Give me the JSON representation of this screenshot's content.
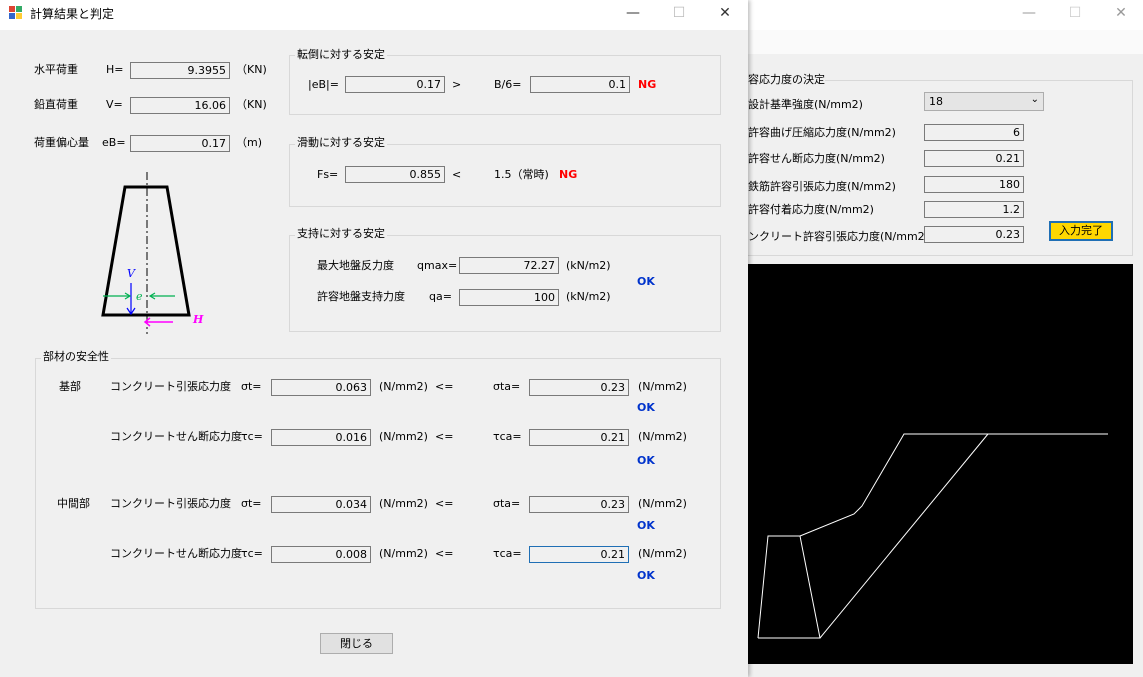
{
  "back_window": {
    "window_buttons": {
      "minimize": "—",
      "maximize": "☐",
      "close": "✕"
    },
    "group_title": "容応力度の決定",
    "rows": [
      {
        "label": "設計基準強度(N/mm2)",
        "value": "18",
        "kind": "select"
      },
      {
        "label": "許容曲げ圧縮応力度(N/mm2)",
        "value": "6"
      },
      {
        "label": "許容せん断応力度(N/mm2)",
        "value": "0.21"
      },
      {
        "label": "鉄筋許容引張応力度(N/mm2)",
        "value": "180"
      },
      {
        "label": "許容付着応力度(N/mm2)",
        "value": "1.2"
      },
      {
        "label": "ンクリート許容引張応力度(N/mm2)",
        "value": "0.23"
      }
    ],
    "submit_button": "入力完了"
  },
  "dialog": {
    "title": "計算結果と判定",
    "window_buttons": {
      "minimize": "—",
      "maximize": "☐",
      "close": "✕"
    },
    "loads": {
      "h": {
        "label": "水平荷重",
        "sym": "H=",
        "value": "9.3955",
        "unit": "（KN)"
      },
      "v": {
        "label": "鉛直荷重",
        "sym": "V=",
        "value": "16.06",
        "unit": "（KN)"
      },
      "e": {
        "label": "荷重偏心量",
        "sym": "eB=",
        "value": "0.17",
        "unit": "（m)"
      }
    },
    "diagram_labels": {
      "v": "V",
      "e": "e",
      "h": "H"
    },
    "overturn": {
      "title": "転倒に対する安定",
      "lhs_label": "|eB|=",
      "lhs_value": "0.17",
      "op": ">",
      "rhs_label": "B/6=",
      "rhs_value": "0.1",
      "result": "NG"
    },
    "sliding": {
      "title": "滑動に対する安定",
      "label": "Fs=",
      "value": "0.855",
      "op": "<",
      "ref": "1.5（常時)",
      "result": "NG"
    },
    "support": {
      "title": "支持に対する安定",
      "qmax": {
        "label": "最大地盤反力度",
        "sym": "qmax=",
        "value": "72.27",
        "unit": "(kN/m2)"
      },
      "qa": {
        "label": "許容地盤支持力度",
        "sym": "qa=",
        "value": "100",
        "unit": "(kN/m2)"
      },
      "result": "OK"
    },
    "member": {
      "title": "部材の安全性",
      "sections": [
        {
          "name": "基部",
          "rows": [
            {
              "label": "コンクリート引張応力度",
              "sym": "σt=",
              "value": "0.063",
              "unit": "(N/mm2)",
              "op": "<=",
              "allow_sym": "σta=",
              "allow_value": "0.23",
              "allow_unit": "(N/mm2)",
              "result": "OK"
            },
            {
              "label": "コンクリートせん断応力度",
              "sym": "τc=",
              "value": "0.016",
              "unit": "(N/mm2)",
              "op": "<=",
              "allow_sym": "τca=",
              "allow_value": "0.21",
              "allow_unit": "(N/mm2)",
              "result": "OK"
            }
          ]
        },
        {
          "name": "中間部",
          "rows": [
            {
              "label": "コンクリート引張応力度",
              "sym": "σt=",
              "value": "0.034",
              "unit": "(N/mm2)",
              "op": "<=",
              "allow_sym": "σta=",
              "allow_value": "0.23",
              "allow_unit": "(N/mm2)",
              "result": "OK"
            },
            {
              "label": "コンクリートせん断応力度",
              "sym": "τc=",
              "value": "0.008",
              "unit": "(N/mm2)",
              "op": "<=",
              "allow_sym": "τca=",
              "allow_value": "0.21",
              "allow_unit": "(N/mm2)",
              "result": "OK"
            }
          ]
        }
      ]
    },
    "close_button": "閉じる"
  },
  "colors": {
    "ng": "#ff0000",
    "ok": "#0033cc",
    "submit_bg": "#ffd700",
    "canvas_bg": "#000000",
    "diagram_magenta": "#ff00ff",
    "diagram_green": "#00b050",
    "diagram_blue": "#0000ff"
  }
}
